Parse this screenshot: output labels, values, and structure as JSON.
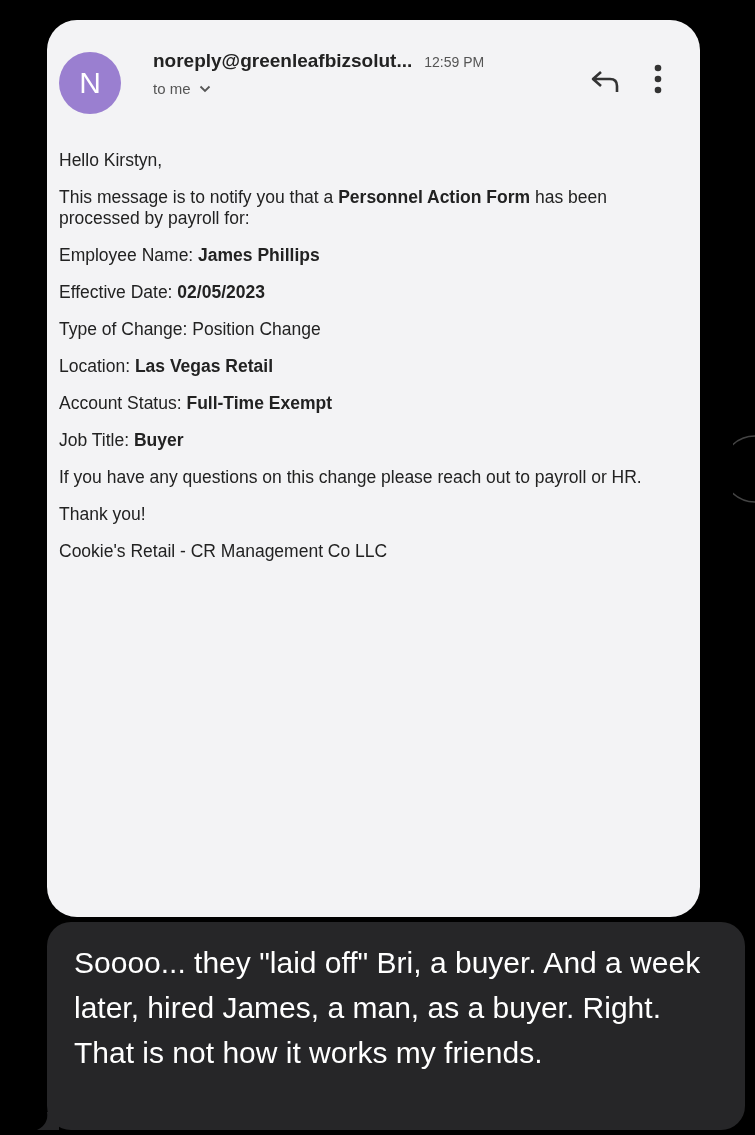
{
  "email": {
    "avatar_letter": "N",
    "sender": "noreply@greenleafbizsolut...",
    "time": "12:59 PM",
    "recipient": "to me",
    "paragraphs": [
      "Hello Kirstyn,",
      "This message is to notify you that a **Personnel Action Form** has been processed by payroll for:",
      "Employee Name: **James Phillips**",
      "Effective Date: **02/05/2023**",
      "Type of Change: Position Change",
      "Location: **Las Vegas Retail**",
      "Account Status: **Full-Time Exempt**",
      "Job Title: **Buyer**",
      "If you have any questions on this change please reach out to payroll or HR.",
      "Thank you!",
      "Cookie's Retail - CR Management Co LLC"
    ]
  },
  "message": {
    "text": "Soooo... they \"laid off\" Bri, a buyer. And a week later, hired James, a man, as a buyer. Right. That is not how it works my friends."
  }
}
